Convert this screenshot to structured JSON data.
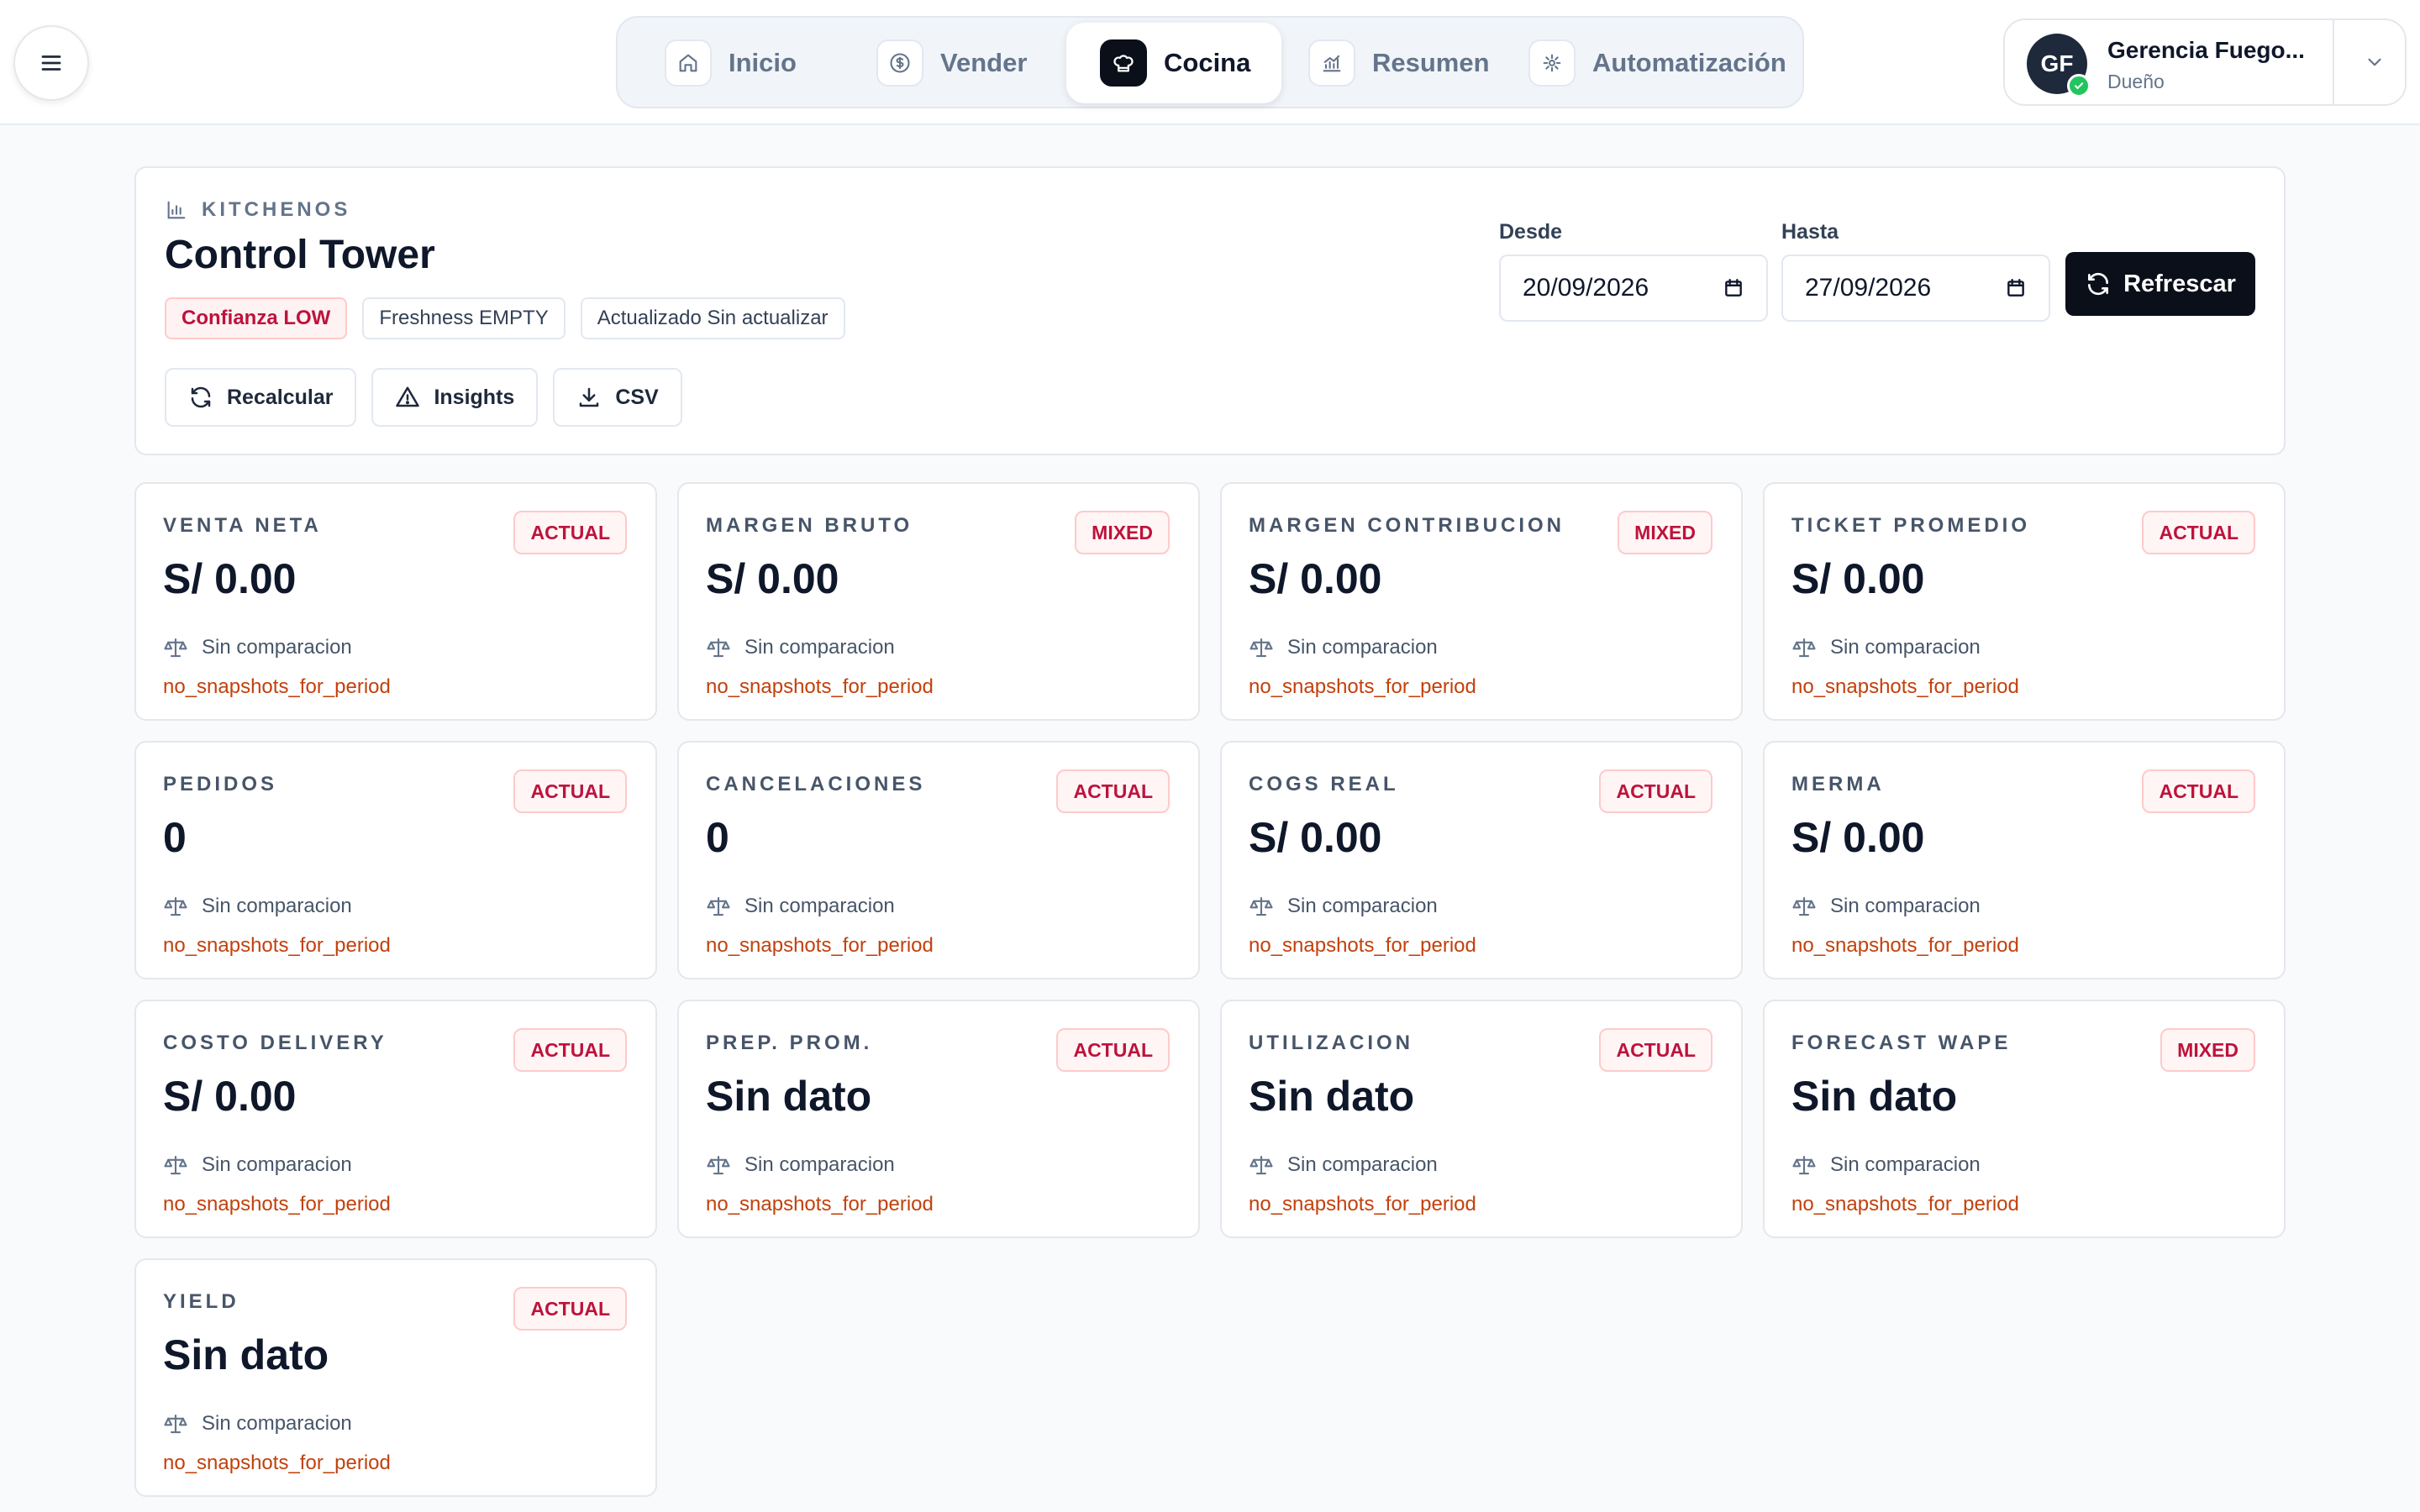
{
  "nav": {
    "items": [
      {
        "label": "Inicio",
        "icon": "home-icon",
        "active": false
      },
      {
        "label": "Vender",
        "icon": "dollar-icon",
        "active": false
      },
      {
        "label": "Cocina",
        "icon": "chef-hat-icon",
        "active": true
      },
      {
        "label": "Resumen",
        "icon": "bar-chart-icon",
        "active": false
      },
      {
        "label": "Automatización",
        "icon": "automation-icon",
        "active": false
      }
    ]
  },
  "profile": {
    "initials": "GF",
    "name": "Gerencia Fuego...",
    "role": "Dueño"
  },
  "header": {
    "eyebrow": "KITCHENOS",
    "title": "Control Tower",
    "chips": [
      "Confianza LOW",
      "Freshness EMPTY",
      "Actualizado Sin actualizar"
    ],
    "actions": [
      "Recalcular",
      "Insights",
      "CSV"
    ],
    "from_label": "Desde",
    "from_value": "20/09/2026",
    "to_label": "Hasta",
    "to_value": "27/09/2026",
    "refresh_label": "Refrescar"
  },
  "kpis": [
    {
      "label": "VENTA NETA",
      "badge": "ACTUAL",
      "value": "S/ 0.00",
      "compare": "Sin comparacion",
      "note": "no_snapshots_for_period"
    },
    {
      "label": "MARGEN BRUTO",
      "badge": "MIXED",
      "value": "S/ 0.00",
      "compare": "Sin comparacion",
      "note": "no_snapshots_for_period"
    },
    {
      "label": "MARGEN CONTRIBUCION",
      "badge": "MIXED",
      "value": "S/ 0.00",
      "compare": "Sin comparacion",
      "note": "no_snapshots_for_period"
    },
    {
      "label": "TICKET PROMEDIO",
      "badge": "ACTUAL",
      "value": "S/ 0.00",
      "compare": "Sin comparacion",
      "note": "no_snapshots_for_period"
    },
    {
      "label": "PEDIDOS",
      "badge": "ACTUAL",
      "value": "0",
      "compare": "Sin comparacion",
      "note": "no_snapshots_for_period"
    },
    {
      "label": "CANCELACIONES",
      "badge": "ACTUAL",
      "value": "0",
      "compare": "Sin comparacion",
      "note": "no_snapshots_for_period"
    },
    {
      "label": "COGS REAL",
      "badge": "ACTUAL",
      "value": "S/ 0.00",
      "compare": "Sin comparacion",
      "note": "no_snapshots_for_period"
    },
    {
      "label": "MERMA",
      "badge": "ACTUAL",
      "value": "S/ 0.00",
      "compare": "Sin comparacion",
      "note": "no_snapshots_for_period"
    },
    {
      "label": "COSTO DELIVERY",
      "badge": "ACTUAL",
      "value": "S/ 0.00",
      "compare": "Sin comparacion",
      "note": "no_snapshots_for_period"
    },
    {
      "label": "PREP. PROM.",
      "badge": "ACTUAL",
      "value": "Sin dato",
      "compare": "Sin comparacion",
      "note": "no_snapshots_for_period"
    },
    {
      "label": "UTILIZACION",
      "badge": "ACTUAL",
      "value": "Sin dato",
      "compare": "Sin comparacion",
      "note": "no_snapshots_for_period"
    },
    {
      "label": "FORECAST WAPE",
      "badge": "MIXED",
      "value": "Sin dato",
      "compare": "Sin comparacion",
      "note": "no_snapshots_for_period"
    },
    {
      "label": "YIELD",
      "badge": "ACTUAL",
      "value": "Sin dato",
      "compare": "Sin comparacion",
      "note": "no_snapshots_for_period"
    }
  ],
  "colors": {
    "accent": "#0b0f19",
    "badge_text": "#be123c",
    "note_text": "#c2410c",
    "status_ok": "#22c55e"
  }
}
